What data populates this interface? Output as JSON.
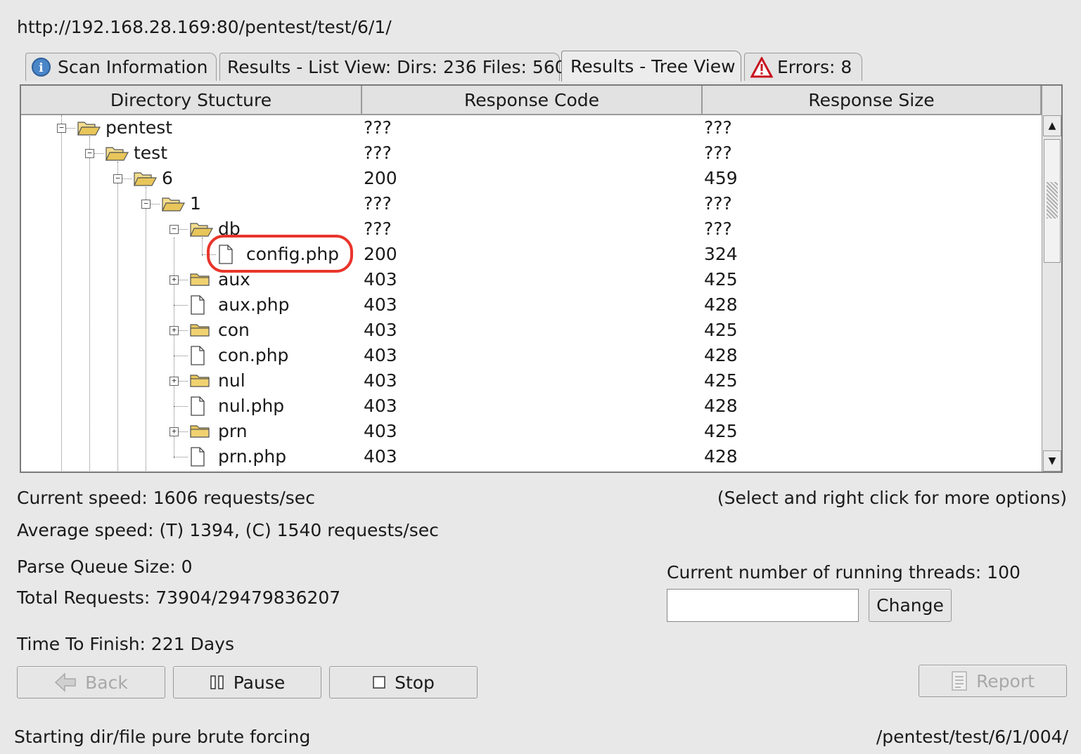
{
  "url": "http://192.168.28.169:80/pentest/test/6/1/",
  "tabs": [
    {
      "label": "Scan Information",
      "icon": "info-icon"
    },
    {
      "label": "Results - List View: Dirs: 236 Files: 560"
    },
    {
      "label": "Results - Tree View",
      "active": true
    },
    {
      "label": "Errors: 8",
      "icon": "warning-icon"
    }
  ],
  "table": {
    "headers": [
      "Directory Stucture",
      "Response Code",
      "Response Size"
    ],
    "rows": [
      {
        "name": "pentest",
        "type": "folder",
        "code": "???",
        "size": "???"
      },
      {
        "name": "test",
        "type": "folder",
        "code": "???",
        "size": "???"
      },
      {
        "name": "6",
        "type": "folder",
        "code": "200",
        "size": "459"
      },
      {
        "name": "1",
        "type": "folder",
        "code": "???",
        "size": "???"
      },
      {
        "name": "db",
        "type": "folder",
        "code": "???",
        "size": "???"
      },
      {
        "name": "config.php",
        "type": "file",
        "code": "200",
        "size": "324"
      },
      {
        "name": "aux",
        "type": "folder",
        "code": "403",
        "size": "425"
      },
      {
        "name": "aux.php",
        "type": "file",
        "code": "403",
        "size": "428"
      },
      {
        "name": "con",
        "type": "folder",
        "code": "403",
        "size": "425"
      },
      {
        "name": "con.php",
        "type": "file",
        "code": "403",
        "size": "428"
      },
      {
        "name": "nul",
        "type": "folder",
        "code": "403",
        "size": "425"
      },
      {
        "name": "nul.php",
        "type": "file",
        "code": "403",
        "size": "428"
      },
      {
        "name": "prn",
        "type": "folder",
        "code": "403",
        "size": "425"
      },
      {
        "name": "prn.php",
        "type": "file",
        "code": "403",
        "size": "428"
      }
    ]
  },
  "stats": {
    "current_speed": "Current speed: 1606 requests/sec",
    "hint": "(Select and right click for more options)",
    "average_speed": "Average speed: (T) 1394, (C) 1540 requests/sec",
    "parse_queue": "Parse Queue Size: 0",
    "total_requests": "Total Requests: 73904/29479836207",
    "time_to_finish": "Time To Finish: 221 Days",
    "threads": "Current number of running threads: 100"
  },
  "threads_input": {
    "value": ""
  },
  "buttons": {
    "change": "Change",
    "back": "Back",
    "pause": "Pause",
    "stop": "Stop",
    "report": "Report"
  },
  "status": {
    "message": "Starting dir/file pure brute forcing",
    "path": "/pentest/test/6/1/004/"
  },
  "colors": {
    "highlight": "#e8352b",
    "folder": "#e8c65a",
    "warning": "#c8141e",
    "info": "#4a86c8"
  }
}
